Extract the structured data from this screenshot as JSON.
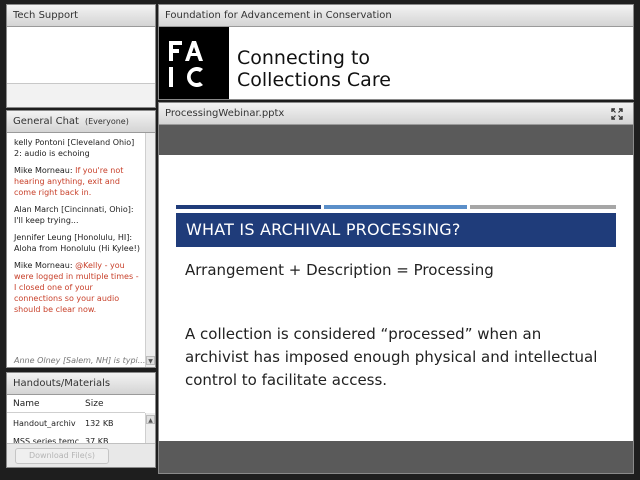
{
  "tech_support": {
    "title": "Tech Support"
  },
  "chat": {
    "title": "General Chat",
    "audience": "(Everyone)",
    "messages": [
      {
        "name": "kelly Pontoni [Cleveland Ohio] 2:",
        "text": " audio is echoing",
        "red": false
      },
      {
        "name": "Mike Morneau:",
        "text": " If you're not hearing anything, exit and come right back in.",
        "red": true
      },
      {
        "name": "Alan March [Cincinnati, Ohio]:",
        "text": " I'll keep trying...",
        "red": false
      },
      {
        "name": "Jennifer Leung [Honolulu, HI]:",
        "text": " Aloha from Honolulu (Hi Kylee!)",
        "red": false
      },
      {
        "name": "Mike Morneau:",
        "text": " @Kelly - you were logged in multiple times - I closed one of your connections so your audio should be clear now.",
        "red": true
      }
    ],
    "typing": "Anne Olney [Salem, NH] is typi..."
  },
  "handouts": {
    "title": "Handouts/Materials",
    "col_name": "Name",
    "col_size": "Size",
    "files": [
      {
        "name": "Handout_archiv",
        "size": "132 KB"
      },
      {
        "name": "MSS series temc",
        "size": "37 KB"
      }
    ],
    "download_label": "Download File(s)"
  },
  "logo_pod": {
    "title": "Foundation for Advancement in Conservation",
    "tagline_1": "Connecting to",
    "tagline_2": "Collections Care",
    "logo_letters": "FAIC"
  },
  "share": {
    "title": "ProcessingWebinar.pptx",
    "slide_title": "WHAT IS ARCHIVAL PROCESSING?",
    "line1": "Arrangement + Description = Processing",
    "line2": "A collection is considered “processed” when an archivist has imposed enough physical and intellectual control to facilitate access."
  },
  "colors": {
    "slide_title_bg": "#1f3c7a",
    "bar_dark": "#1f3c7a",
    "bar_light": "#5b8fc9",
    "bar_gray": "#a6a6a6",
    "chat_red": "#c8412b"
  }
}
